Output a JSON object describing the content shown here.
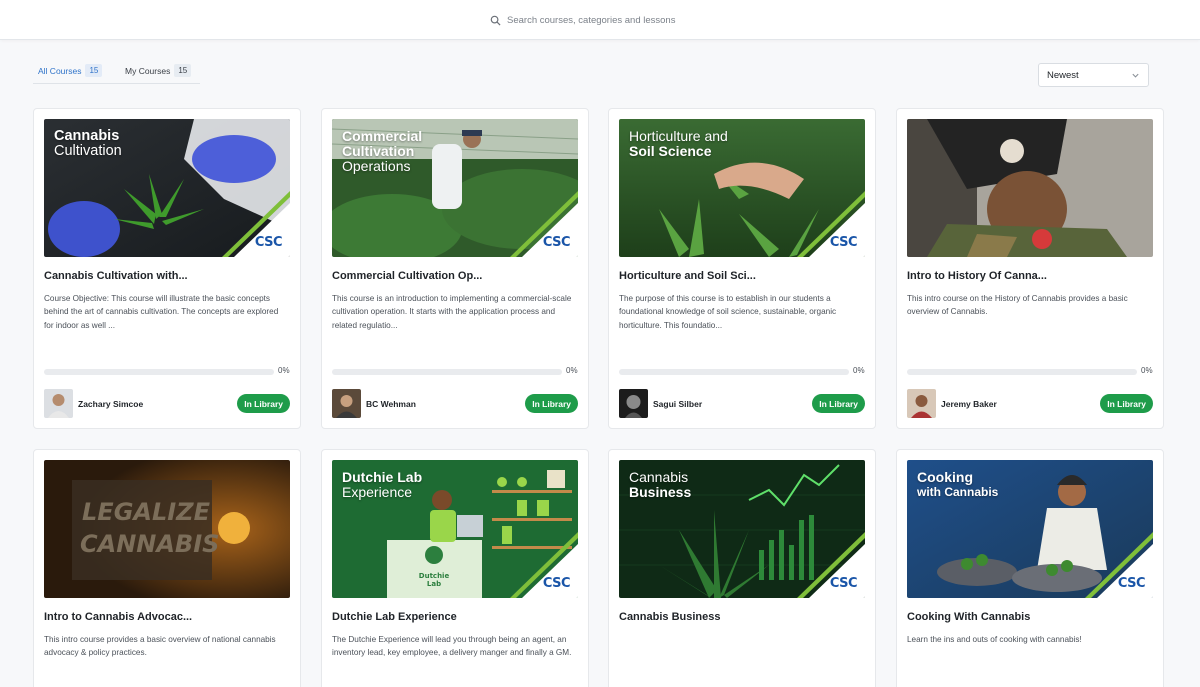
{
  "search": {
    "placeholder": "Search courses, categories and lessons"
  },
  "tabs": [
    {
      "label": "All Courses",
      "count": "15"
    },
    {
      "label": "My Courses",
      "count": "15"
    }
  ],
  "sort": {
    "selected": "Newest"
  },
  "colors": {
    "accent": "#2f73c9",
    "library_green": "#1e9c4a",
    "csc_blue": "#1a55a8"
  },
  "courses": [
    {
      "thumb_title": "Cannabis",
      "thumb_subtitle": "Cultivation",
      "title": "Cannabis Cultivation with...",
      "description": "Course Objective: This course will illustrate the basic concepts behind the art of cannabis cultivation. The concepts are explored for indoor as well ...",
      "progress_percent": 0,
      "progress_label": "0%",
      "author": "Zachary Simcoe",
      "status": "In Library",
      "csc": "CSC"
    },
    {
      "thumb_title": "Commercial",
      "thumb_subtitle": "Cultivation",
      "thumb_subtitle2": "Operations",
      "title": "Commercial Cultivation Op...",
      "description": "This course is an introduction to implementing a commercial-scale cultivation operation. It starts with the application process and related regulatio...",
      "progress_percent": 0,
      "progress_label": "0%",
      "author": "BC Wehman",
      "status": "In Library",
      "csc": "CSC"
    },
    {
      "thumb_title": "Horticulture and",
      "thumb_subtitle": "Soil Science",
      "title": "Horticulture and Soil Sci...",
      "description": "The purpose of this course is to establish in our students a foundational knowledge of soil science, sustainable, organic horticulture. This foundatio...",
      "progress_percent": 0,
      "progress_label": "0%",
      "author": "Sagui Silber",
      "status": "In Library",
      "csc": "CSC"
    },
    {
      "title": "Intro to History Of Canna...",
      "description": "This intro course on the History of Cannabis provides a basic overview of Cannabis.",
      "progress_percent": 0,
      "progress_label": "0%",
      "author": "Jeremy Baker",
      "status": "In Library"
    },
    {
      "thumb_sign": "LEGALIZE",
      "thumb_sign2": "CANNABIS",
      "title": "Intro to Cannabis Advocac...",
      "description": "This intro course provides a basic overview of national cannabis advocacy & policy practices."
    },
    {
      "thumb_title": "Dutchie Lab",
      "thumb_subtitle": "Experience",
      "thumb_sign": "Dutchie",
      "thumb_sign2": "Lab",
      "title": "Dutchie Lab Experience",
      "description": "The Dutchie Experience will lead you through being an agent, an inventory lead, key employee, a delivery manger and finally a GM.",
      "csc": "CSC"
    },
    {
      "thumb_title": "Cannabis",
      "thumb_subtitle": "Business",
      "title": "Cannabis Business",
      "description": "",
      "csc": "CSC"
    },
    {
      "thumb_title": "Cooking",
      "thumb_subtitle": "with Cannabis",
      "title": "Cooking With Cannabis",
      "description": "Learn the ins and outs of cooking with cannabis!",
      "csc": "CSC"
    }
  ]
}
